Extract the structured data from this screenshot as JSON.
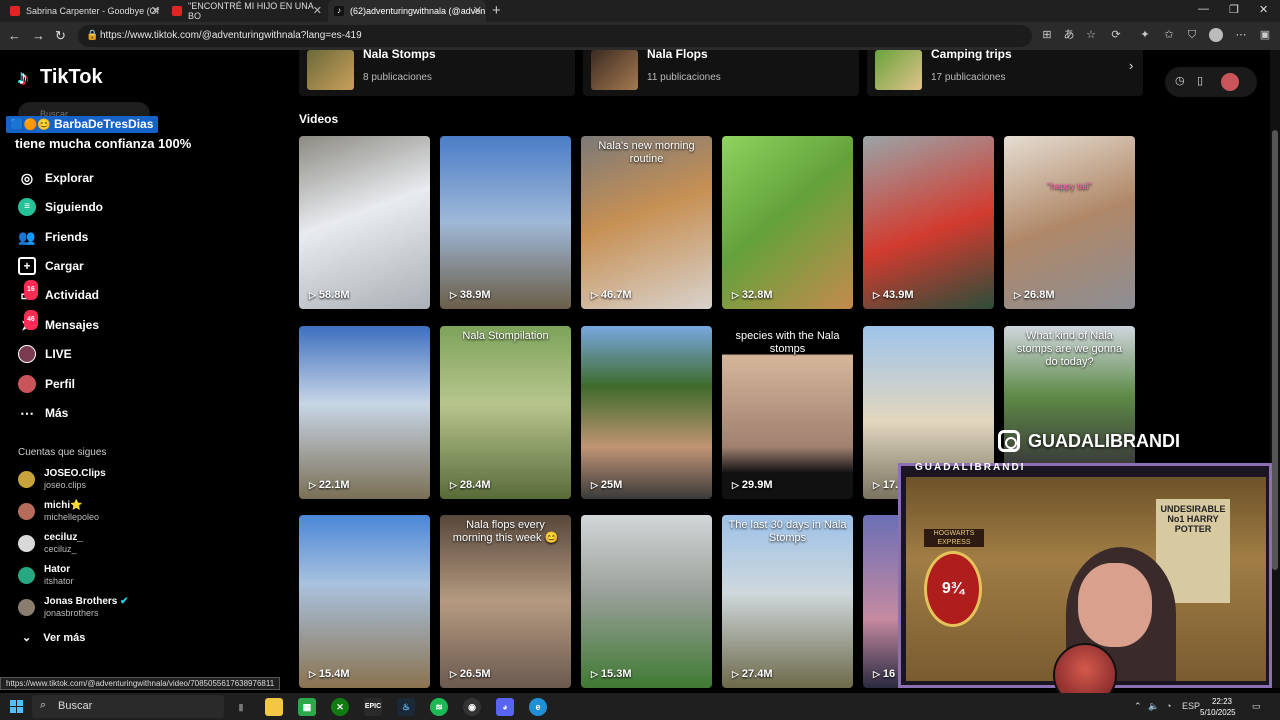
{
  "browser": {
    "tabs": [
      {
        "title": "Sabrina Carpenter - Goodbye (Of",
        "color": "#e02424"
      },
      {
        "title": "\"ENCONTRÉ MI HIJO EN UNA BO",
        "color": "#e02424"
      },
      {
        "title": "(62)adventuringwithnala (@adven",
        "color": "#ffffff"
      }
    ],
    "url": "https://www.tiktok.com/@adventuringwithnala?lang=es-419",
    "status_url": "https://www.tiktok.com/@adventuringwithnala/video/7085055617638976811"
  },
  "sidebar": {
    "logo_text": "TikTok",
    "search_placeholder": "Buscar",
    "stream_user": "BarbaDeTresDias",
    "stream_message": "tiene mucha confianza 100%",
    "nav": [
      {
        "label": "Explorar",
        "icon": "compass-icon"
      },
      {
        "label": "Siguiendo",
        "icon": "following-icon"
      },
      {
        "label": "Friends",
        "icon": "friends-icon"
      },
      {
        "label": "Cargar",
        "icon": "upload-icon"
      },
      {
        "label": "Actividad",
        "icon": "activity-icon",
        "badge": "16"
      },
      {
        "label": "Mensajes",
        "icon": "messages-icon",
        "badge": "46"
      },
      {
        "label": "LIVE",
        "icon": "live-icon"
      },
      {
        "label": "Perfil",
        "icon": "profile-icon"
      },
      {
        "label": "Más",
        "icon": "more-icon"
      }
    ],
    "following_title": "Cuentas que sigues",
    "following": [
      {
        "name": "JOSEO.Clips",
        "handle": "joseo.clips"
      },
      {
        "name": "michi⭐",
        "handle": "michellepoleo"
      },
      {
        "name": "ceciluz_",
        "handle": "ceciluz_"
      },
      {
        "name": "Hator",
        "handle": "itshator"
      },
      {
        "name": "Jonas Brothers",
        "handle": "jonasbrothers"
      }
    ],
    "see_more": "Ver más"
  },
  "collections": [
    {
      "title": "Nala Stomps",
      "count": "8 publicaciones"
    },
    {
      "title": "Nala Flops",
      "count": "11 publicaciones"
    },
    {
      "title": "Camping trips",
      "count": "17 publicaciones"
    }
  ],
  "videos_heading": "Videos",
  "videos": [
    {
      "views": "58.8M",
      "caption": ""
    },
    {
      "views": "38.9M",
      "caption": ""
    },
    {
      "views": "46.7M",
      "caption": "Nala's new morning routine"
    },
    {
      "views": "32.8M",
      "caption": ""
    },
    {
      "views": "43.9M",
      "caption": ""
    },
    {
      "views": "26.8M",
      "caption": "\"happy tail\""
    },
    {
      "views": "22.1M",
      "caption": ""
    },
    {
      "views": "28.4M",
      "caption": "Nala Stompilation"
    },
    {
      "views": "25M",
      "caption": ""
    },
    {
      "views": "29.9M",
      "caption": "species with the Nala stomps"
    },
    {
      "views": "17.5",
      "caption": ""
    },
    {
      "views": "",
      "caption": "What kind of Nala stomps are we gonna do today?"
    },
    {
      "views": "15.4M",
      "caption": ""
    },
    {
      "views": "26.5M",
      "caption": "Nala flops every morning this week 😊"
    },
    {
      "views": "15.3M",
      "caption": ""
    },
    {
      "views": "27.4M",
      "caption": "The last 30 days in Nala Stomps"
    },
    {
      "views": "16",
      "caption": ""
    }
  ],
  "overlay": {
    "instagram_handle": "GUADALIBRANDI",
    "cam_name": "GUADALIBRANDI",
    "poster_platform": "9¾",
    "poster_wanted": "UNDESIRABLE No1 HARRY POTTER",
    "poster_express": "HOGWARTS EXPRESS"
  },
  "taskbar": {
    "search": "Buscar",
    "lang": "ESP",
    "time": "22:23",
    "date": "5/10/2025"
  }
}
